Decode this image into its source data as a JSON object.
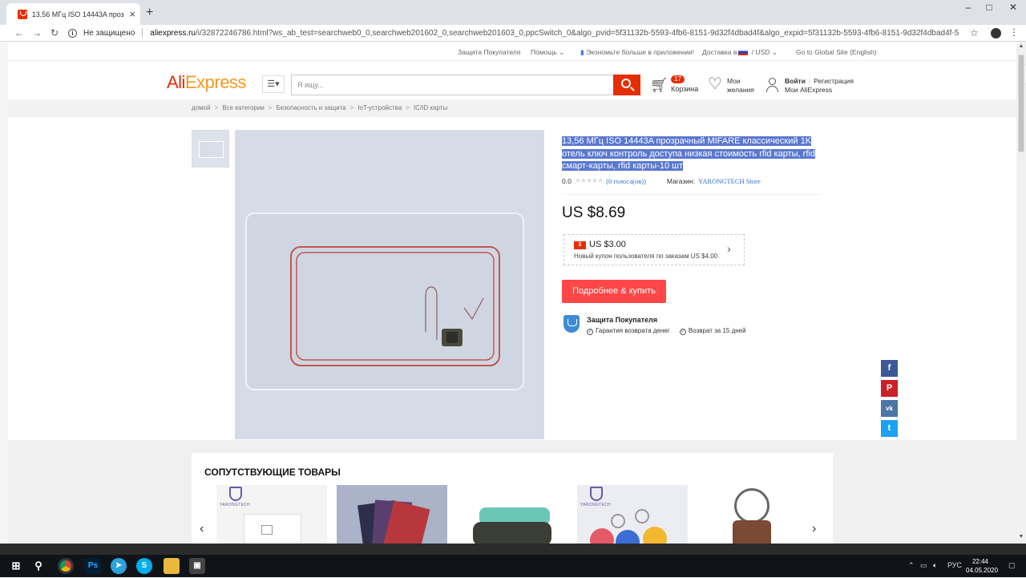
{
  "browser": {
    "tab_title": "13,56 МГц ISO 14443A прозрачн",
    "security_label": "Не защищено",
    "url_domain": "aliexpress.ru",
    "url_path": "/i/32872246786.html?ws_ab_test=searchweb0_0,searchweb201602_0,searchweb201603_0,ppcSwitch_0&algo_pvid=5f31132b-5593-4fb6-8151-9d32f4dbad4f&algo_expid=5f31132b-5593-4fb6-8151-9d32f4dbad4f-5"
  },
  "topbar": {
    "buyer_protection": "Защита Покупателя",
    "help": "Помощь",
    "app_promo": "Экономьте больше в приложении!",
    "shipping_to": "Доставка в",
    "currency": "USD",
    "global_site": "Go to Global Site (English)"
  },
  "header": {
    "logo": "AliExpress",
    "search_placeholder": "Я ищу...",
    "cart_count": "17",
    "cart_label": "Корзина",
    "wishlist_label": "Мои желания",
    "login": "Войти",
    "register": "Регистрация",
    "my_account": "Мои AliExpress"
  },
  "breadcrumb": [
    "домой",
    "Все категории",
    "Безопасность и защита",
    "IoT-устройства",
    "IC/ID карты"
  ],
  "product": {
    "title": "13,56 МГц ISO 14443A прозрачный MIFARE классический 1K отель ключ контроль доступа низкая стоимость rfid карты, rfid смарт-карты, rfid карты-10 шт",
    "rating": "0.0",
    "votes": "(0 голоса(ов))",
    "store_label": "Магазин:",
    "store_name": "YARONGTECH Store",
    "price": "US $8.69",
    "coupon_amount": "US $3.00",
    "coupon_desc": "Новый купон пользователя по заказам US $4.00",
    "buy_button": "Подробнее & купить",
    "protection_title": "Защита Покупателя",
    "protection_items": [
      "Гарантия возврата денег",
      "Возврат за 15 дней"
    ]
  },
  "related": {
    "title": "СОПУТСТВУЮЩИЕ ТОВАРЫ",
    "brand_text": "YARONGTECH"
  },
  "taskbar": {
    "language": "РУС",
    "time": "22:44",
    "date": "04.05.2020"
  },
  "colors": {
    "brand_red": "#e62e04",
    "buy_button": "#ff4747",
    "selection": "#5a78d0"
  }
}
